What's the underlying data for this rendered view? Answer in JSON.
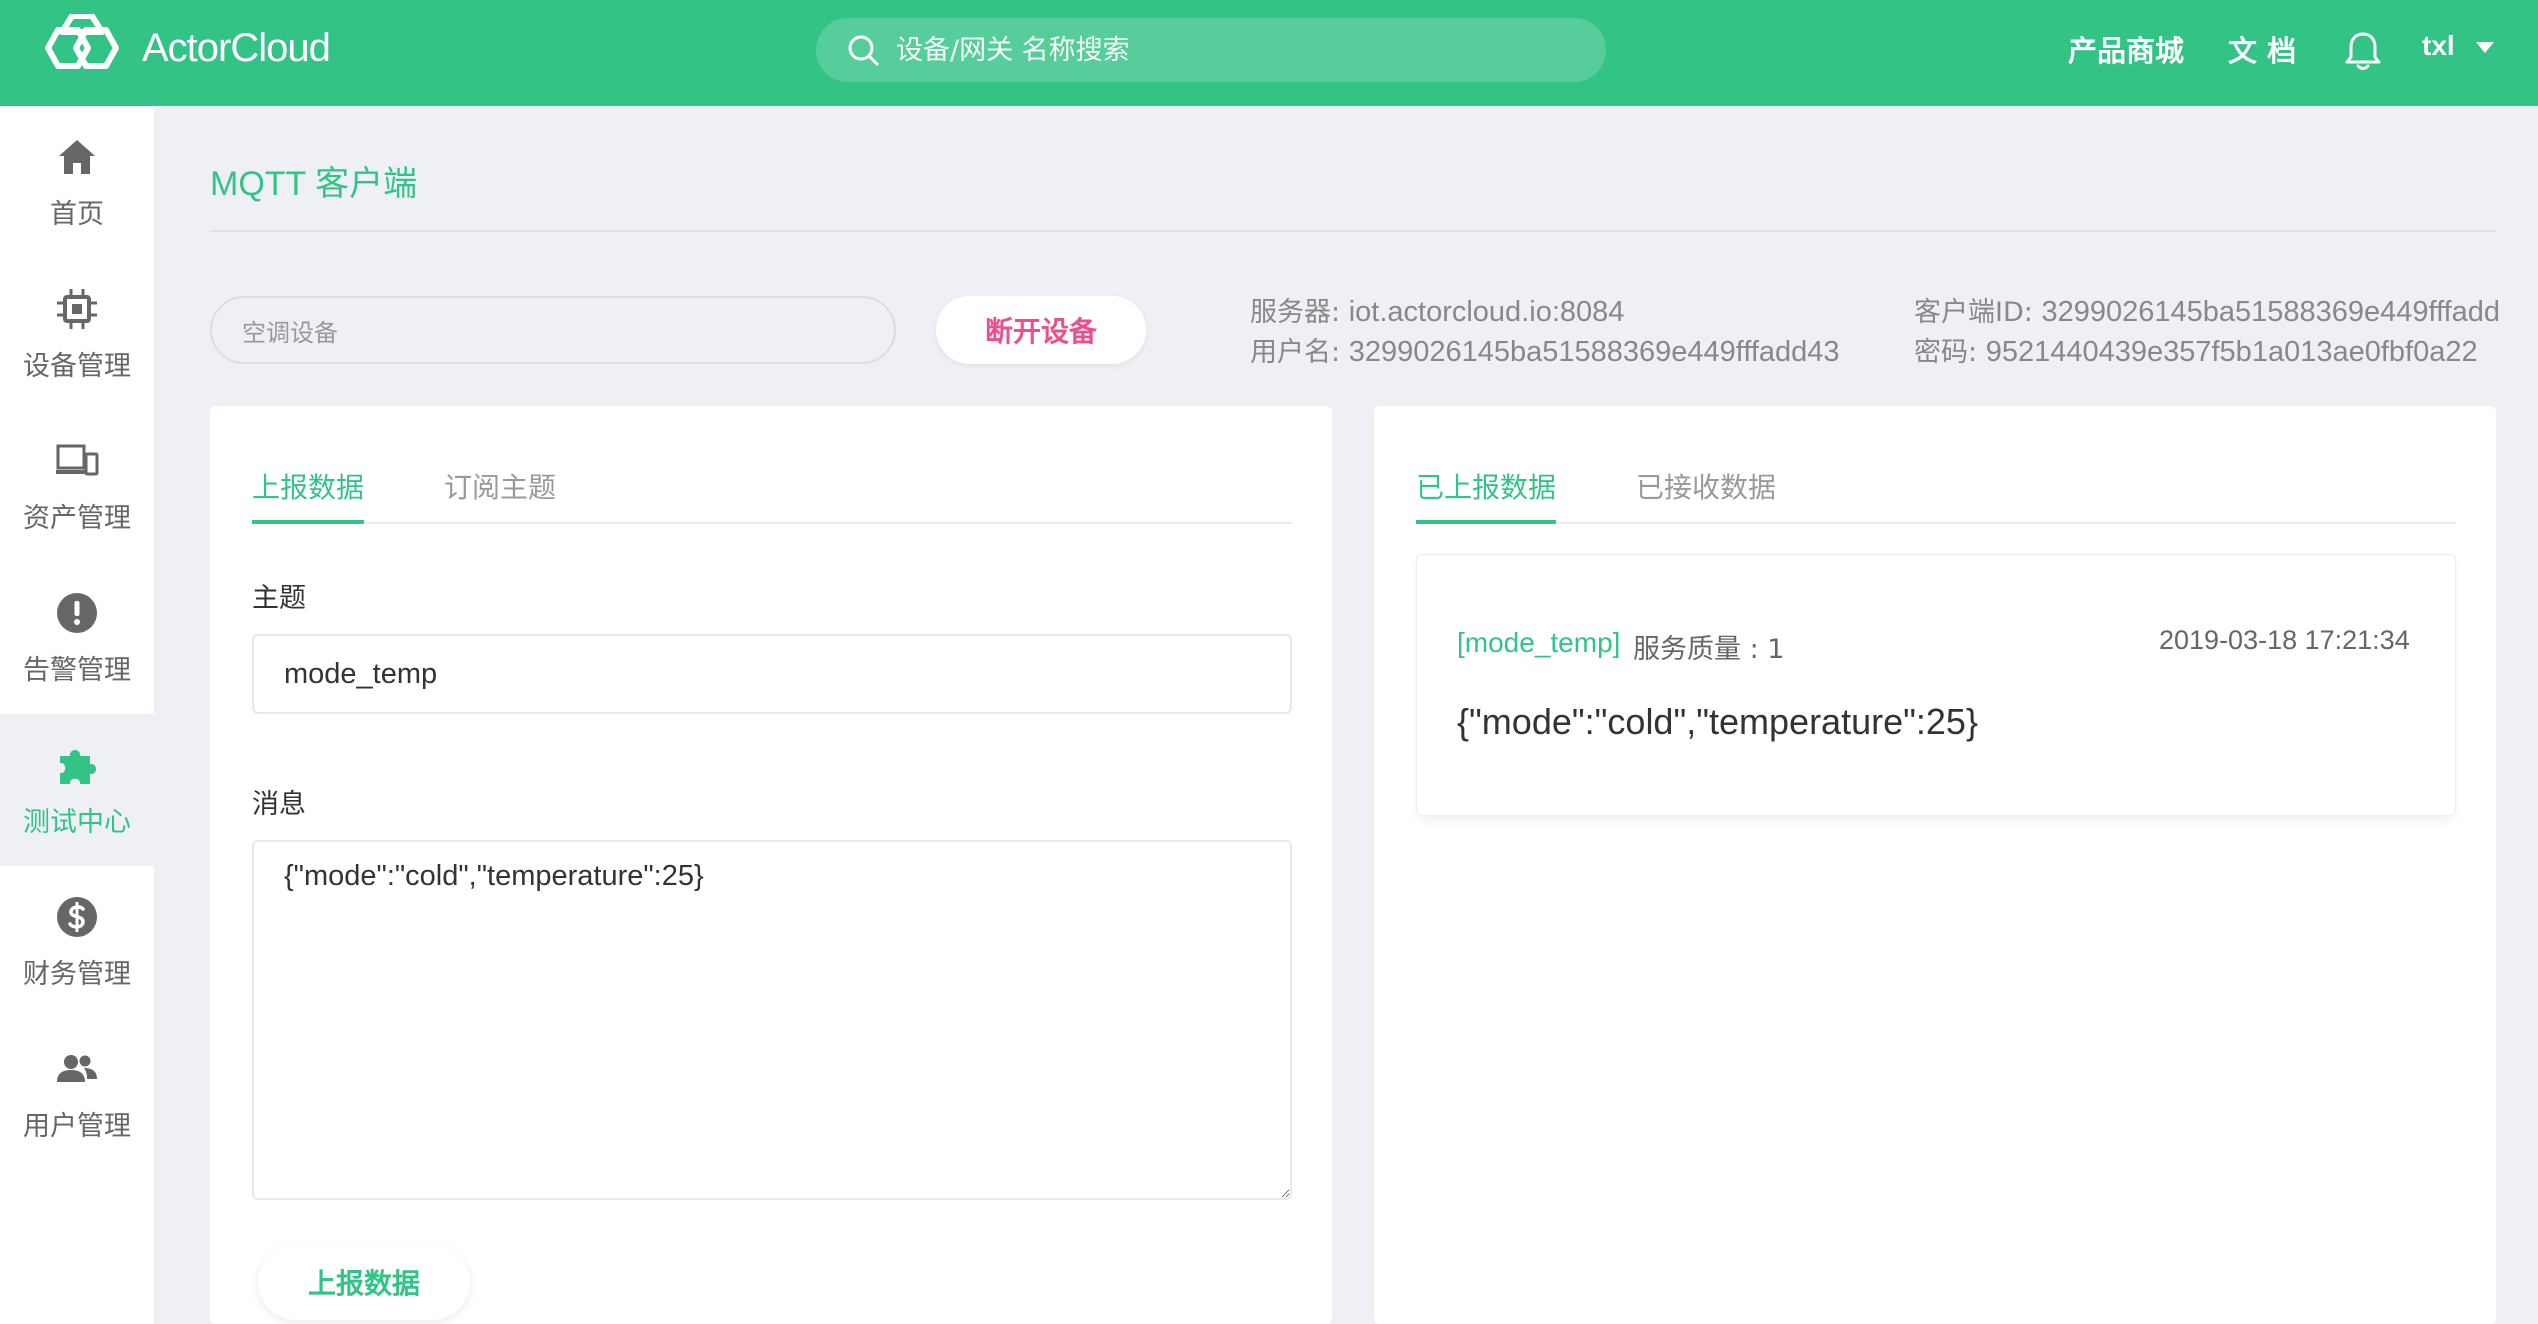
{
  "header": {
    "brand": "ActorCloud",
    "search_placeholder": "设备/网关 名称搜索",
    "links": [
      "产品商城",
      "文 档"
    ],
    "user": "txl"
  },
  "sidebar": {
    "items": [
      {
        "label": "首页",
        "icon": "home-icon"
      },
      {
        "label": "设备管理",
        "icon": "chip-icon"
      },
      {
        "label": "资产管理",
        "icon": "devices-icon"
      },
      {
        "label": "告警管理",
        "icon": "alert-icon"
      },
      {
        "label": "测试中心",
        "icon": "puzzle-icon",
        "active": true
      },
      {
        "label": "财务管理",
        "icon": "dollar-icon"
      },
      {
        "label": "用户管理",
        "icon": "users-icon"
      }
    ]
  },
  "page": {
    "title_en": "MQTT",
    "title_cn": "客户端"
  },
  "device": {
    "placeholder": "空调设备",
    "disconnect_label": "断开设备"
  },
  "connection": {
    "server_label": "服务器:",
    "server_value": "iot.actorcloud.io:8084",
    "username_label": "用户名:",
    "username_value": "3299026145ba51588369e449fffadd43",
    "client_id_label": "客户端ID:",
    "client_id_value": "3299026145ba51588369e449fffadd",
    "password_label": "密码:",
    "password_value": "9521440439e357f5b1a013ae0fbf0a22"
  },
  "publish": {
    "tabs": [
      "上报数据",
      "订阅主题"
    ],
    "topic_label": "主题",
    "topic_value": "mode_temp",
    "message_label": "消息",
    "message_value": "{\"mode\":\"cold\",\"temperature\":25}",
    "submit_label": "上报数据"
  },
  "messages": {
    "tabs": [
      "已上报数据",
      "已接收数据"
    ],
    "items": [
      {
        "topic": "[mode_temp]",
        "qos": "服务质量 : 1",
        "time": "2019-03-18 17:21:34",
        "payload": "{\"mode\":\"cold\",\"temperature\":25}"
      }
    ]
  },
  "colors": {
    "brand": "#33c387",
    "danger": "#e8508f",
    "background": "#eef0f5"
  }
}
